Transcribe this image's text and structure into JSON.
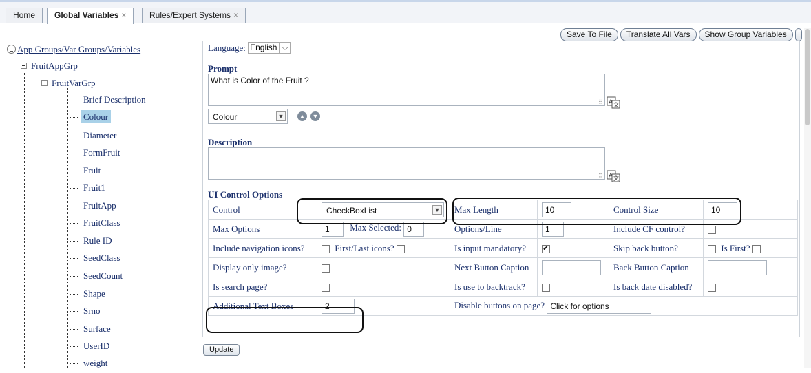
{
  "tabs": [
    {
      "label": "Home",
      "close": ""
    },
    {
      "label": "Global Variables",
      "close": "×"
    },
    {
      "label": "Rules/Expert Systems",
      "close": "×"
    }
  ],
  "tree": {
    "root_label": "App Groups/Var Groups/Variables",
    "app_group": "FruitAppGrp",
    "var_group": "FruitVarGrp",
    "variables": [
      "Brief Description",
      "Colour",
      "Diameter",
      "FormFruit",
      "Fruit",
      "Fruit1",
      "FruitApp",
      "FruitClass",
      "Rule ID",
      "SeedClass",
      "SeedCount",
      "Shape",
      "Srno",
      "Surface",
      "UserID",
      "weight"
    ],
    "selected": "Colour"
  },
  "toolbar": {
    "save_to_file": "Save To File",
    "translate_all": "Translate All Vars",
    "show_group": "Show Group Variables"
  },
  "form": {
    "language_label": "Language:",
    "language_value": "English",
    "prompt_title": "Prompt",
    "prompt_text": "What is Color of the Fruit ?",
    "variable_select": "Colour",
    "description_title": "Description",
    "description_text": "",
    "ui_options_title": "UI Control Options",
    "update_label": "Update"
  },
  "ui_options": {
    "control_label": "Control",
    "control_value": "CheckBoxList",
    "max_length_label": "Max Length",
    "max_length_value": "10",
    "control_size_label": "Control Size",
    "control_size_value": "10",
    "max_options_label": "Max Options",
    "max_options_value": "1",
    "max_selected_label": "Max Selected:",
    "max_selected_value": "0",
    "options_line_label": "Options/Line",
    "options_line_value": "1",
    "include_cf_label": "Include CF control?",
    "include_cf_checked": false,
    "include_nav_label": "Include navigation icons?",
    "include_nav_checked": false,
    "first_last_label": "First/Last icons?",
    "first_last_checked": false,
    "mandatory_label": "Is input mandatory?",
    "mandatory_checked": true,
    "skip_back_label": "Skip back button?",
    "skip_back_checked": false,
    "is_first_label": "Is First?",
    "is_first_checked": false,
    "display_image_label": "Display only image?",
    "display_image_checked": false,
    "next_caption_label": "Next Button Caption",
    "next_caption_value": "",
    "back_caption_label": "Back Button Caption",
    "back_caption_value": "",
    "search_page_label": "Is search page?",
    "search_page_checked": false,
    "backtrack_label": "Is use to backtrack?",
    "backtrack_checked": false,
    "back_date_label": "Is back date disabled?",
    "back_date_checked": false,
    "additional_text_label": "Additional Text Boxes",
    "additional_text_value": "2",
    "disable_buttons_label": "Disable buttons on page?",
    "disable_buttons_value": "Click for options"
  }
}
